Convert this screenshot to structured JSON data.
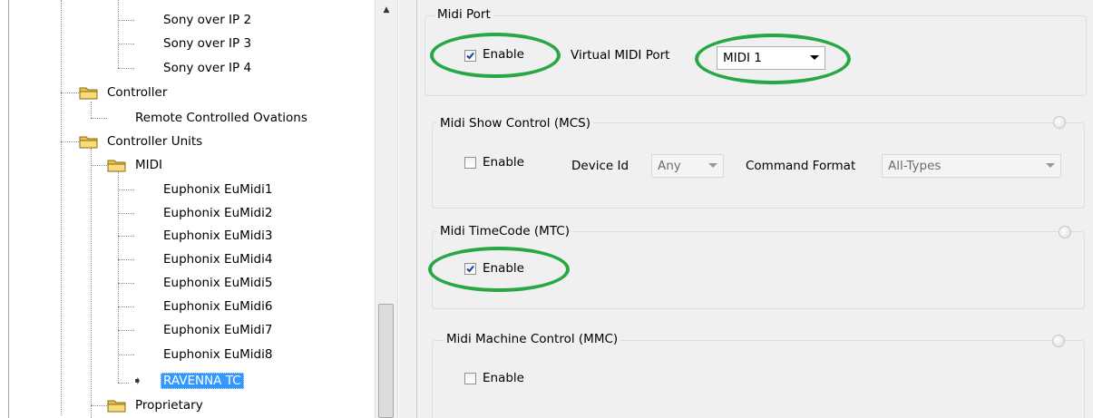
{
  "tree": {
    "items": [
      {
        "label": "Sony over IP 2"
      },
      {
        "label": "Sony over IP 3"
      },
      {
        "label": "Sony over IP 4"
      },
      {
        "label": "Controller"
      },
      {
        "label": "Remote Controlled Ovations"
      },
      {
        "label": "Controller Units"
      },
      {
        "label": "MIDI"
      },
      {
        "label": "Euphonix EuMidi1"
      },
      {
        "label": "Euphonix EuMidi2"
      },
      {
        "label": "Euphonix EuMidi3"
      },
      {
        "label": "Euphonix EuMidi4"
      },
      {
        "label": "Euphonix EuMidi5"
      },
      {
        "label": "Euphonix EuMidi6"
      },
      {
        "label": "Euphonix EuMidi7"
      },
      {
        "label": "Euphonix EuMidi8"
      },
      {
        "label": "RAVENNA TC"
      },
      {
        "label": "Proprietary"
      }
    ],
    "selected": "RAVENNA TC"
  },
  "groups": {
    "midi_port": {
      "title": "Midi Port",
      "enable_label": "Enable",
      "enable_checked": true,
      "virtual_port_label": "Virtual MIDI Port",
      "virtual_port_value": "MIDI 1"
    },
    "mcs": {
      "title": "Midi Show Control (MCS)",
      "enable_label": "Enable",
      "enable_checked": false,
      "device_id_label": "Device Id",
      "device_id_value": "Any",
      "command_format_label": "Command Format",
      "command_format_value": "All-Types"
    },
    "mtc": {
      "title": "Midi TimeCode (MTC)",
      "enable_label": "Enable",
      "enable_checked": true
    },
    "mmc": {
      "title": "Midi Machine Control (MMC)",
      "enable_label": "Enable",
      "enable_checked": false
    }
  },
  "colors": {
    "highlight_oval": "#28a745",
    "selection": "#3399ff"
  },
  "icons": {
    "folder": "folder-icon",
    "current_item": "arrow-right-icon"
  }
}
